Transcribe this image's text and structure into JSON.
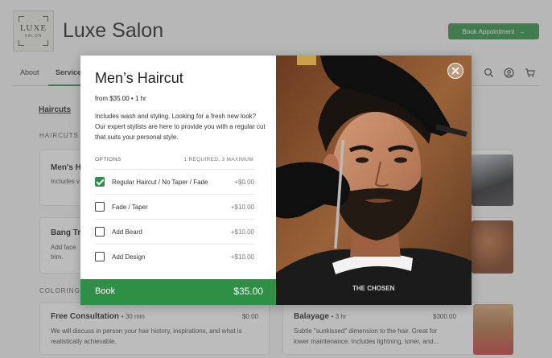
{
  "header": {
    "logo_text": "LUXE",
    "logo_sub": "SALON",
    "brand": "Luxe Salon",
    "book_button": "Book Appointment",
    "book_arrow": "→"
  },
  "nav": {
    "items": [
      "About",
      "Services"
    ],
    "active": "Services",
    "icons": [
      "search-icon",
      "account-icon",
      "cart-icon"
    ]
  },
  "sections": {
    "link": "Haircuts",
    "haircuts_heading": "HAIRCUTS",
    "coloring_heading": "COLORING"
  },
  "cards": {
    "mens_title": "Men's H",
    "mens_text": "Includes v",
    "bang_title": "Bang Tri",
    "bang_text_1": "Add face",
    "bang_text_2": "trim.",
    "consult_title": "Free Consultation",
    "consult_meta": "30 min",
    "consult_price": "$0.00",
    "consult_text_1": "We will discuss in person your hair history, inspirations, and what is",
    "consult_text_2": "realistically achievable.",
    "balayage_title": "Balayage",
    "balayage_meta": "3 hr",
    "balayage_price": "$300.00",
    "balayage_text_1": "Subtle \"sunkissed\" dimension to the hair. Great for",
    "balayage_text_2": "lower maintenance. Includes lightning, toner, and..."
  },
  "modal": {
    "title": "Men’s Haircut",
    "subtitle": "from $35.00 • 1 hr",
    "description": "Includes wash and styling. Looking for a fresh new look? Our expert stylists are here to provide you with a regular cut that suits your personal style.",
    "options_heading": "OPTIONS",
    "options_limit": "1 REQUIRED, 3 MAXIMUM",
    "options": [
      {
        "label": "Regular Haircut / No Taper / Fade",
        "price": "+$0.00",
        "checked": true
      },
      {
        "label": "Fade / Taper",
        "price": "+$10.00",
        "checked": false
      },
      {
        "label": "Add Beard",
        "price": "+$10.00",
        "checked": false
      },
      {
        "label": "Add Design",
        "price": "+$10.00",
        "checked": false
      }
    ],
    "book_label": "Book",
    "book_total": "$35.00"
  },
  "colors": {
    "accent": "#2f8f46"
  }
}
